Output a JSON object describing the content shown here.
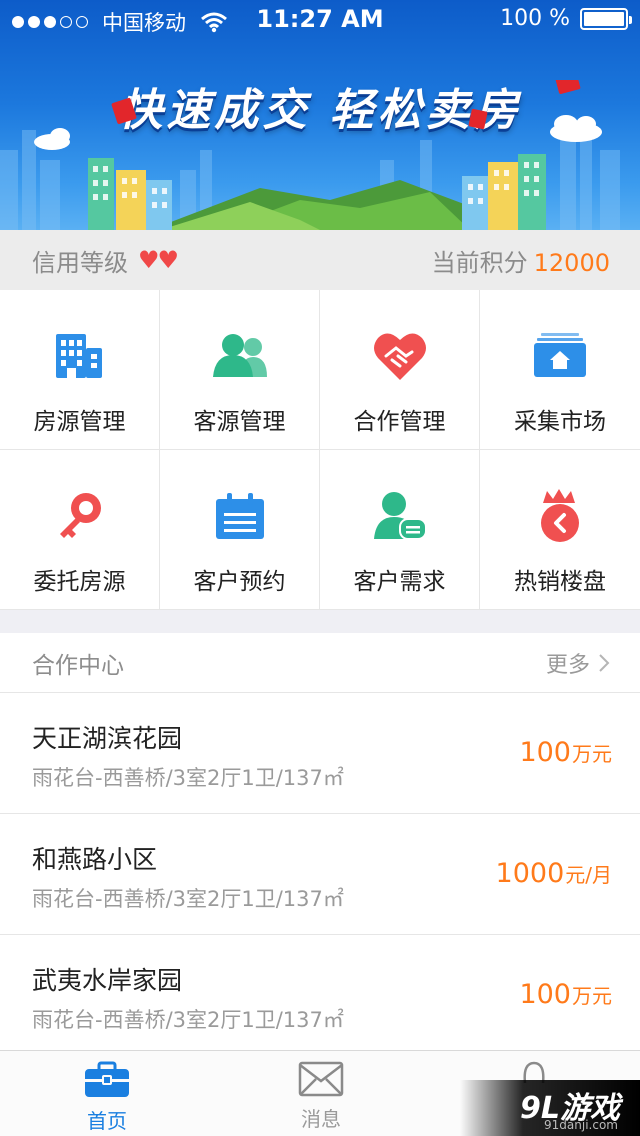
{
  "status_bar": {
    "carrier": "中国移动",
    "time": "11:27 AM",
    "battery": "100 %"
  },
  "banner": {
    "slogan": "快速成交 轻松卖房"
  },
  "credit": {
    "level_label": "信用等级",
    "hearts": "♥♥",
    "points_label": "当前积分",
    "points_value": "12000"
  },
  "grid": {
    "items": [
      {
        "label": "房源管理",
        "icon": "building-icon"
      },
      {
        "label": "客源管理",
        "icon": "users-icon"
      },
      {
        "label": "合作管理",
        "icon": "handshake-heart-icon"
      },
      {
        "label": "采集市场",
        "icon": "house-stack-icon"
      },
      {
        "label": "委托房源",
        "icon": "key-icon"
      },
      {
        "label": "客户预约",
        "icon": "calendar-icon"
      },
      {
        "label": "客户需求",
        "icon": "user-message-icon"
      },
      {
        "label": "热销楼盘",
        "icon": "fire-icon"
      }
    ]
  },
  "coop": {
    "title": "合作中心",
    "more": "更多",
    "listings": [
      {
        "name": "天正湖滨花园",
        "detail": "雨花台-西善桥/3室2厅1卫/137㎡",
        "price": "100",
        "unit": "万元"
      },
      {
        "name": "和燕路小区",
        "detail": "雨花台-西善桥/3室2厅1卫/137㎡",
        "price": "1000",
        "unit": "元/月"
      },
      {
        "name": "武夷水岸家园",
        "detail": "雨花台-西善桥/3室2厅1卫/137㎡",
        "price": "100",
        "unit": "万元"
      }
    ]
  },
  "tabbar": {
    "items": [
      {
        "label": "首页",
        "icon": "briefcase-icon",
        "active": true
      },
      {
        "label": "消息",
        "icon": "envelope-icon",
        "active": false
      },
      {
        "label": "",
        "icon": "user-icon",
        "active": false
      }
    ]
  },
  "watermark": {
    "text": "9L游戏",
    "url": "91danji.com"
  },
  "colors": {
    "accent": "#1a7fe0",
    "price": "#ff7a1a",
    "heart": "#f04848",
    "teal_icon": "#2eb88a",
    "blue_icon": "#2d8fe8",
    "red_icon": "#f05050"
  }
}
